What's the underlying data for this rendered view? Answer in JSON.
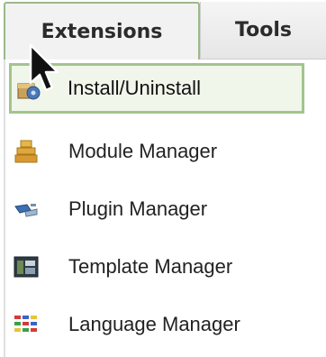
{
  "menubar": {
    "tabs": [
      {
        "label": "Extensions"
      },
      {
        "label": "Tools"
      }
    ]
  },
  "dropdown": {
    "items": [
      {
        "label": "Install/Uninstall",
        "icon": "install-icon"
      },
      {
        "label": "Module Manager",
        "icon": "module-icon"
      },
      {
        "label": "Plugin Manager",
        "icon": "plugin-icon"
      },
      {
        "label": "Template Manager",
        "icon": "template-icon"
      },
      {
        "label": "Language Manager",
        "icon": "language-icon"
      }
    ]
  },
  "colors": {
    "active_border": "#a3c48e",
    "active_fill": "#f0f6ea"
  }
}
